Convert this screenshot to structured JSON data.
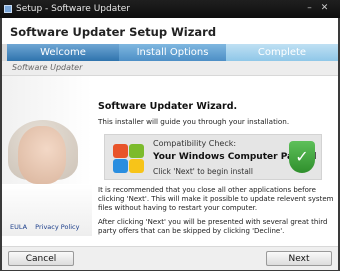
{
  "titlebar": {
    "title": "Setup - Software Updater"
  },
  "header": {
    "title": "Software Updater Setup Wizard"
  },
  "steps": {
    "labels": [
      "Welcome",
      "Install Options",
      "Complete"
    ]
  },
  "subbar": {
    "label": "Software Updater"
  },
  "content": {
    "heading": "Software Updater Wizard.",
    "intro": "This installer will guide you through your installation.",
    "compat": {
      "check_label": "Compatibility Check:",
      "status": "Your Windows Computer Passed",
      "hint": "Click 'Next' to begin install"
    },
    "para1": "It is recommended that you close all other applications before clicking 'Next'. This will make it possible to update relevent system files without having to restart your computer.",
    "para2": "After clicking 'Next' you will be presented with several great third party offers that can be skipped by clicking 'Decline'."
  },
  "links": {
    "eula": "EULA",
    "privacy": "Privacy Policy"
  },
  "footer": {
    "cancel": "Cancel",
    "next": "Next"
  },
  "colors": {
    "accent": "#2f73ad",
    "pass_green": "#3fa23a"
  }
}
